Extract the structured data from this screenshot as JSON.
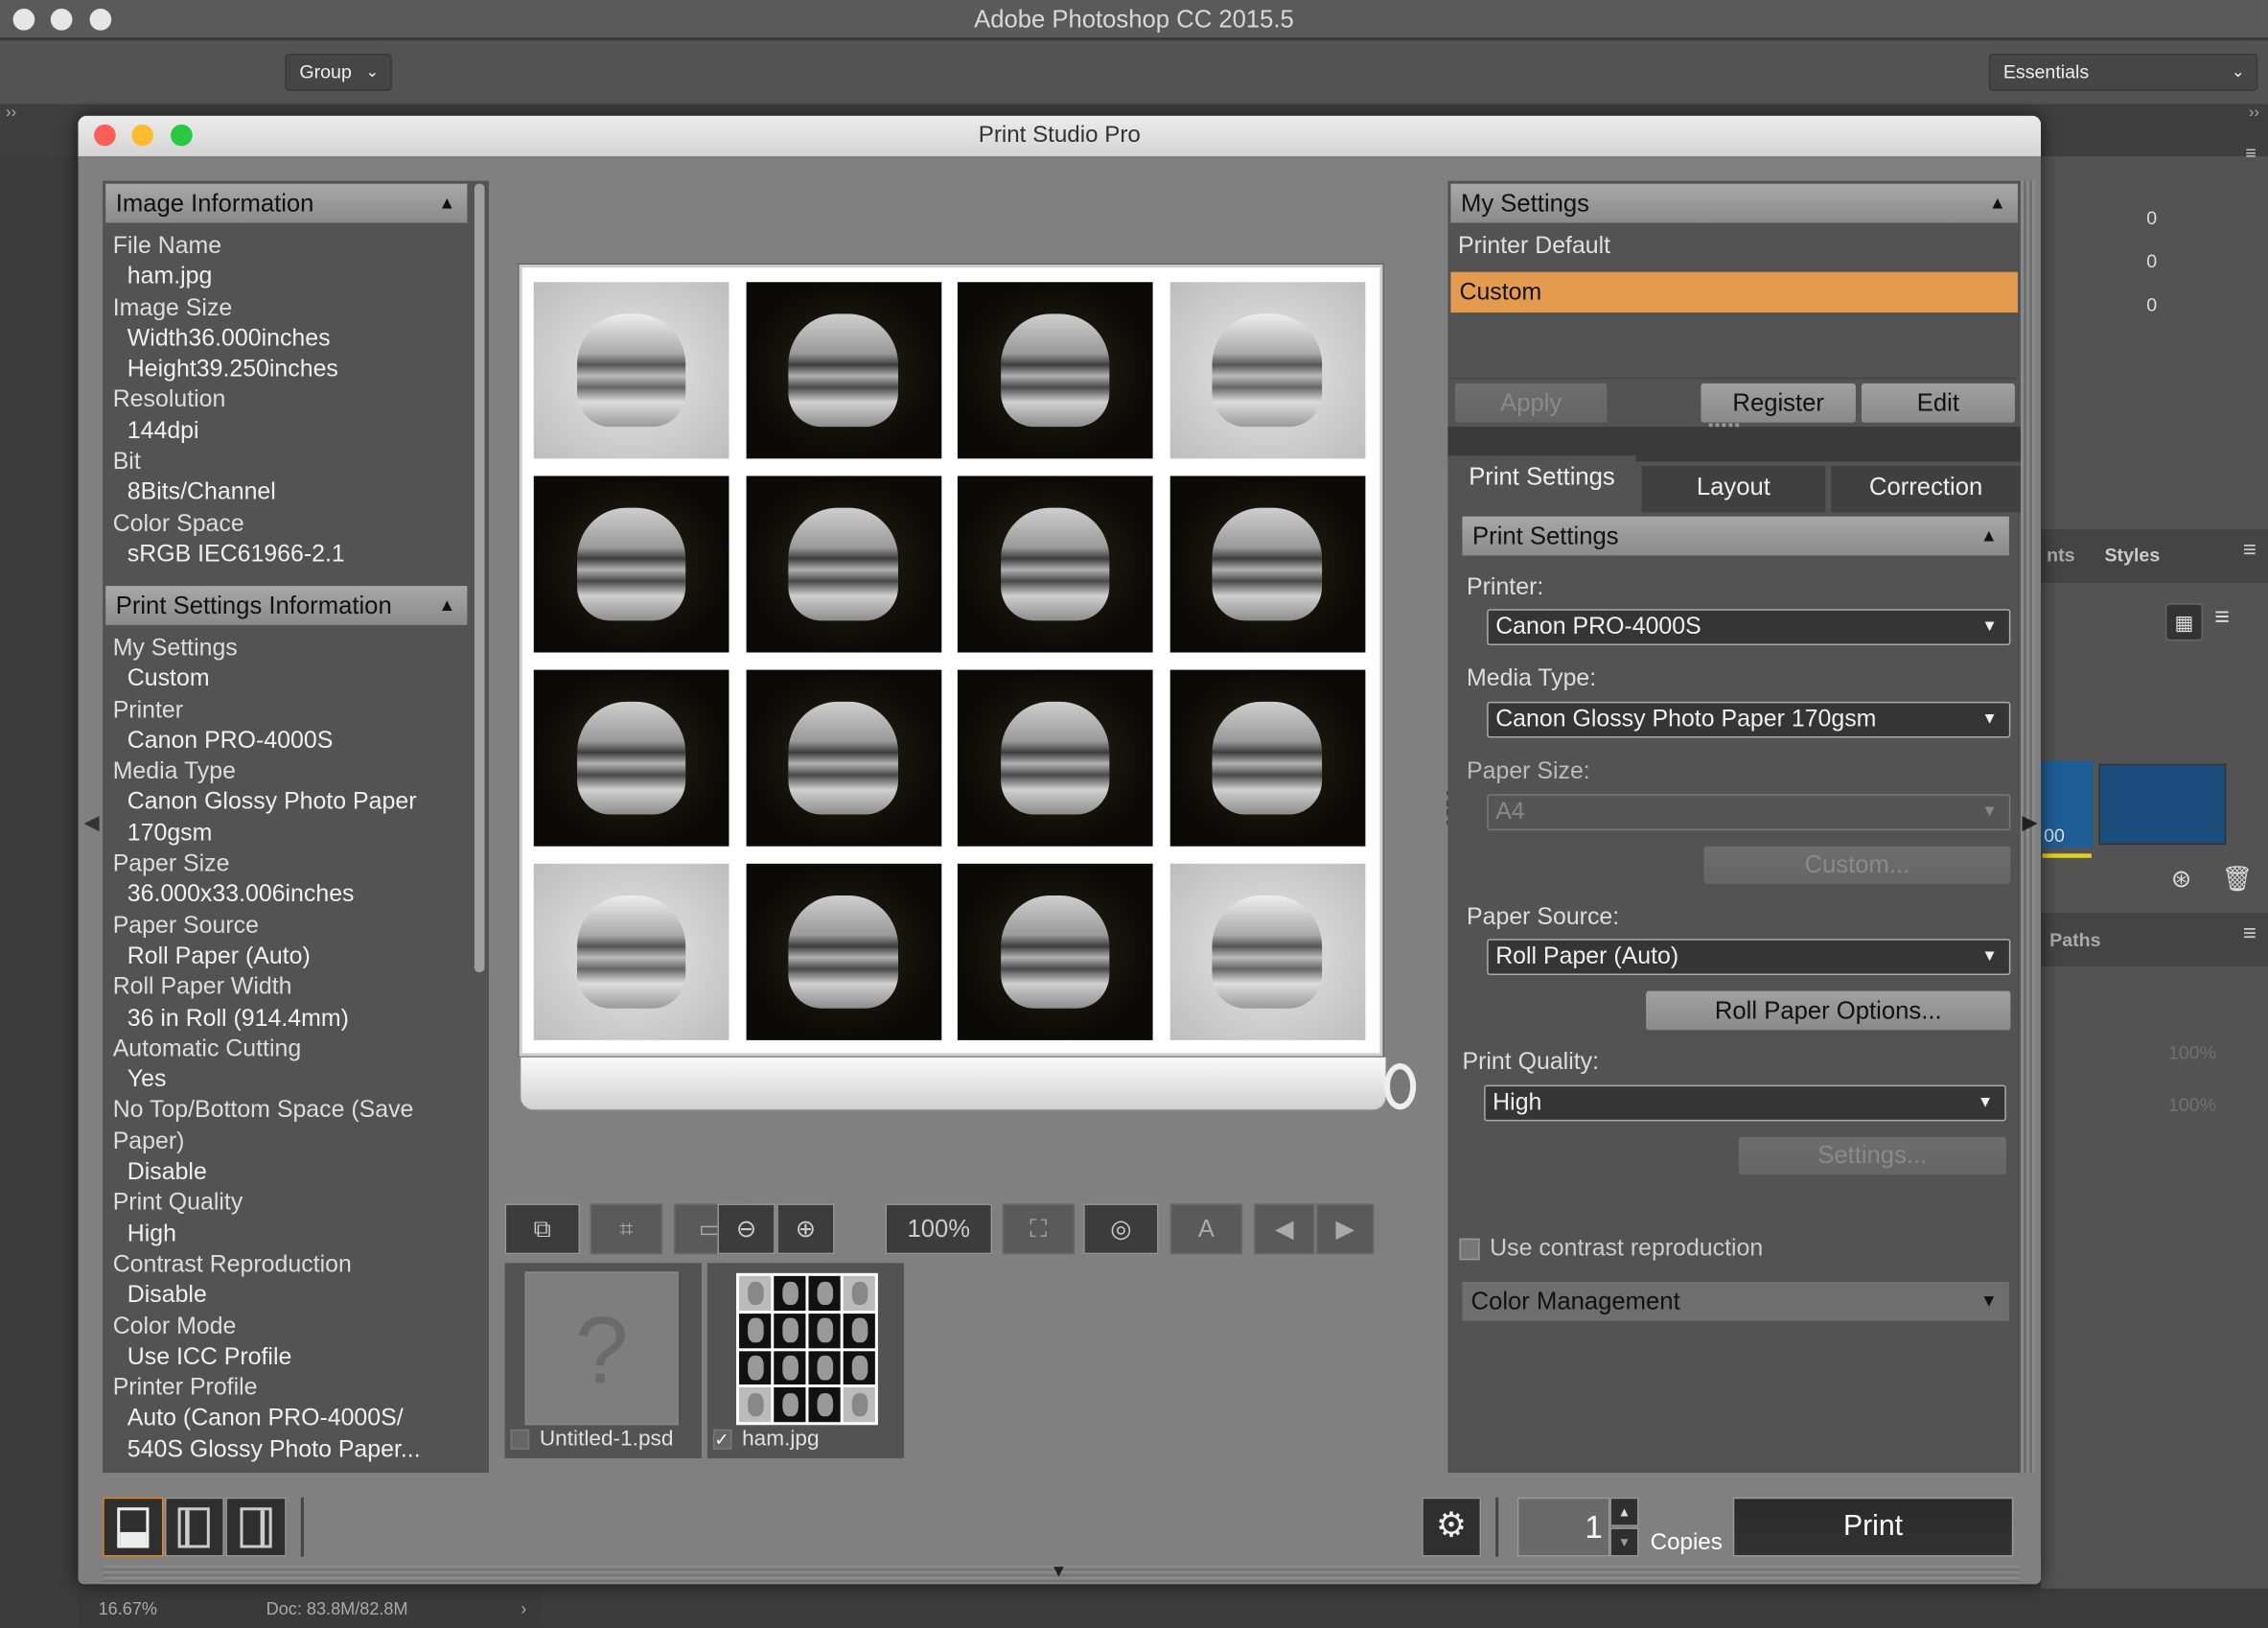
{
  "app": {
    "title": "Adobe Photoshop CC 2015.5",
    "group_dropdown": "Group",
    "workspace_dropdown": "Essentials"
  },
  "dialog": {
    "title": "Print Studio Pro",
    "image_information": {
      "header": "Image Information",
      "rows": [
        {
          "label": "File Name",
          "value": "ham.jpg"
        },
        {
          "label": "Image Size",
          "value": "Width36.000inches"
        },
        {
          "label": "",
          "value": "Height39.250inches"
        },
        {
          "label": "Resolution",
          "value": "144dpi"
        },
        {
          "label": "Bit",
          "value": "8Bits/Channel"
        },
        {
          "label": "Color Space",
          "value": "sRGB IEC61966-2.1"
        }
      ]
    },
    "print_settings_information": {
      "header": "Print Settings Information",
      "lines": [
        {
          "t": "My Settings",
          "v": false
        },
        {
          "t": "Custom",
          "v": true
        },
        {
          "t": "Printer",
          "v": false
        },
        {
          "t": "Canon PRO-4000S",
          "v": true
        },
        {
          "t": "Media Type",
          "v": false
        },
        {
          "t": "Canon Glossy Photo Paper",
          "v": true
        },
        {
          "t": "170gsm",
          "v": true
        },
        {
          "t": "Paper Size",
          "v": false
        },
        {
          "t": "36.000x33.006inches",
          "v": true
        },
        {
          "t": "Paper Source",
          "v": false
        },
        {
          "t": "Roll Paper (Auto)",
          "v": true
        },
        {
          "t": "Roll Paper Width",
          "v": false
        },
        {
          "t": "36 in Roll (914.4mm)",
          "v": true
        },
        {
          "t": "Automatic Cutting",
          "v": false
        },
        {
          "t": "Yes",
          "v": true
        },
        {
          "t": "No Top/Bottom Space (Save",
          "v": false
        },
        {
          "t": "Paper)",
          "v": false
        },
        {
          "t": "Disable",
          "v": true
        },
        {
          "t": "Print Quality",
          "v": false
        },
        {
          "t": "High",
          "v": true
        },
        {
          "t": "Contrast Reproduction",
          "v": false
        },
        {
          "t": "Disable",
          "v": true
        },
        {
          "t": "Color Mode",
          "v": false
        },
        {
          "t": "Use ICC Profile",
          "v": true
        },
        {
          "t": "Printer Profile",
          "v": false
        },
        {
          "t": "Auto (Canon PRO-4000S/",
          "v": true
        },
        {
          "t": "540S Glossy Photo Paper...",
          "v": true
        }
      ]
    },
    "preview": {
      "grid_tones": [
        "light",
        "dark",
        "dark",
        "light",
        "dark",
        "dark",
        "dark",
        "dark",
        "dark",
        "dark",
        "dark",
        "dark",
        "light",
        "dark",
        "dark",
        "light"
      ]
    },
    "toolbar": {
      "zoom_value": "100%"
    },
    "thumbnails": [
      {
        "name": "Untitled-1.psd",
        "checked": false,
        "icon": "question-mark-icon"
      },
      {
        "name": "ham.jpg",
        "checked": true
      }
    ],
    "my_settings": {
      "header": "My Settings",
      "items": [
        "Printer Default",
        "Custom"
      ],
      "selected": "Custom",
      "apply": "Apply",
      "register": "Register",
      "edit": "Edit"
    },
    "tabs": [
      "Print Settings",
      "Layout",
      "Correction"
    ],
    "active_tab": "Print Settings",
    "print_settings": {
      "header": "Print Settings",
      "printer_label": "Printer:",
      "printer": "Canon PRO-4000S",
      "media_label": "Media Type:",
      "media": "Canon Glossy Photo Paper 170gsm",
      "size_label": "Paper Size:",
      "size": "A4",
      "custom_btn": "Custom...",
      "source_label": "Paper Source:",
      "source": "Roll Paper (Auto)",
      "roll_btn": "Roll Paper Options...",
      "quality_label": "Print Quality:",
      "quality": "High",
      "settings_btn": "Settings...",
      "contrast_label": "Use contrast reproduction",
      "contrast_checked": false,
      "color_mgmt": "Color Management"
    },
    "footer": {
      "copies": "1",
      "copies_label": "Copies",
      "print": "Print"
    },
    "colors": {
      "selected": "#e59b4f",
      "accent_border": "#e58a1f"
    }
  },
  "right_panels": {
    "values": [
      "0",
      "0",
      "0"
    ],
    "tab_partial": "nts",
    "tab_styles": "Styles",
    "swatch_label": "00",
    "paths_tab": "Paths",
    "opacity": "100%",
    "fill": "100%"
  },
  "status": {
    "zoom": "16.67%",
    "doc": "Doc: 83.8M/82.8M"
  }
}
